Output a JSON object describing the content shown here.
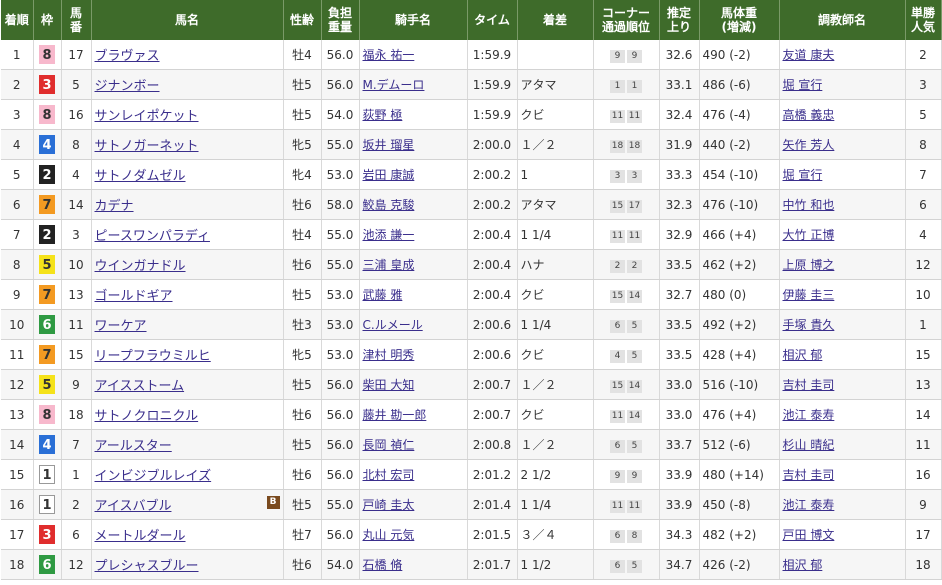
{
  "headers": [
    "着順",
    "枠",
    "馬\n番",
    "馬名",
    "性齢",
    "負担\n重量",
    "騎手名",
    "タイム",
    "着差",
    "コーナー\n通過順位",
    "推定\n上り",
    "馬体重\n(増減)",
    "調教師名",
    "単勝\n人気"
  ],
  "waku_colors": {
    "1": {
      "bg": "#ffffff",
      "fg": "#333333",
      "border": "#999999"
    },
    "2": {
      "bg": "#222222",
      "fg": "#ffffff",
      "border": "#222222"
    },
    "3": {
      "bg": "#e02d2d",
      "fg": "#ffffff",
      "border": "#e02d2d"
    },
    "4": {
      "bg": "#2a6fd6",
      "fg": "#ffffff",
      "border": "#2a6fd6"
    },
    "5": {
      "bg": "#f5e21a",
      "fg": "#333333",
      "border": "#f5e21a"
    },
    "6": {
      "bg": "#2f9a43",
      "fg": "#ffffff",
      "border": "#2f9a43"
    },
    "7": {
      "bg": "#f39a22",
      "fg": "#333333",
      "border": "#f39a22"
    },
    "8": {
      "bg": "#f7b8cc",
      "fg": "#333333",
      "border": "#f7b8cc"
    }
  },
  "rows": [
    {
      "rank": "1",
      "waku": "8",
      "umaban": "17",
      "horse": "ブラヴァス",
      "sex_age": "牡4",
      "weight": "56.0",
      "jockey": "福永 祐一",
      "time": "1:59.9",
      "margin": "",
      "corner": [
        "9",
        "9"
      ],
      "last3f": "32.6",
      "body_weight": "490 (-2)",
      "trainer": "友道 康夫",
      "popularity": "2"
    },
    {
      "rank": "2",
      "waku": "3",
      "umaban": "5",
      "horse": "ジナンボー",
      "sex_age": "牡5",
      "weight": "56.0",
      "jockey": "M.デムーロ",
      "time": "1:59.9",
      "margin": "アタマ",
      "corner": [
        "1",
        "1"
      ],
      "last3f": "33.1",
      "body_weight": "486 (-6)",
      "trainer": "堀 宣行",
      "popularity": "3"
    },
    {
      "rank": "3",
      "waku": "8",
      "umaban": "16",
      "horse": "サンレイポケット",
      "sex_age": "牡5",
      "weight": "54.0",
      "jockey": "荻野 極",
      "time": "1:59.9",
      "margin": "クビ",
      "corner": [
        "11",
        "11"
      ],
      "last3f": "32.4",
      "body_weight": "476 (-4)",
      "trainer": "高橋 義忠",
      "popularity": "5"
    },
    {
      "rank": "4",
      "waku": "4",
      "umaban": "8",
      "horse": "サトノガーネット",
      "sex_age": "牝5",
      "weight": "55.0",
      "jockey": "坂井 瑠星",
      "time": "2:00.0",
      "margin": "１／２",
      "corner": [
        "18",
        "18"
      ],
      "last3f": "31.9",
      "body_weight": "440 (-2)",
      "trainer": "矢作 芳人",
      "popularity": "8"
    },
    {
      "rank": "5",
      "waku": "2",
      "umaban": "4",
      "horse": "サトノダムゼル",
      "sex_age": "牝4",
      "weight": "53.0",
      "jockey": "岩田 康誠",
      "time": "2:00.2",
      "margin": "1",
      "corner": [
        "3",
        "3"
      ],
      "last3f": "33.3",
      "body_weight": "454 (-10)",
      "trainer": "堀 宣行",
      "popularity": "7"
    },
    {
      "rank": "6",
      "waku": "7",
      "umaban": "14",
      "horse": "カデナ",
      "sex_age": "牡6",
      "weight": "58.0",
      "jockey": "鮫島 克駿",
      "time": "2:00.2",
      "margin": "アタマ",
      "corner": [
        "15",
        "17"
      ],
      "last3f": "32.3",
      "body_weight": "476 (-10)",
      "trainer": "中竹 和也",
      "popularity": "6"
    },
    {
      "rank": "7",
      "waku": "2",
      "umaban": "3",
      "horse": "ピースワンパラディ",
      "sex_age": "牡4",
      "weight": "55.0",
      "jockey": "池添 謙一",
      "time": "2:00.4",
      "margin": "1 1/4",
      "corner": [
        "11",
        "11"
      ],
      "last3f": "32.9",
      "body_weight": "466 (+4)",
      "trainer": "大竹 正博",
      "popularity": "4"
    },
    {
      "rank": "8",
      "waku": "5",
      "umaban": "10",
      "horse": "ウインガナドル",
      "sex_age": "牡6",
      "weight": "55.0",
      "jockey": "三浦 皇成",
      "time": "2:00.4",
      "margin": "ハナ",
      "corner": [
        "2",
        "2"
      ],
      "last3f": "33.5",
      "body_weight": "462 (+2)",
      "trainer": "上原 博之",
      "popularity": "12"
    },
    {
      "rank": "9",
      "waku": "7",
      "umaban": "13",
      "horse": "ゴールドギア",
      "sex_age": "牡5",
      "weight": "53.0",
      "jockey": "武藤 雅",
      "time": "2:00.4",
      "margin": "クビ",
      "corner": [
        "15",
        "14"
      ],
      "last3f": "32.7",
      "body_weight": "480 (0)",
      "trainer": "伊藤 圭三",
      "popularity": "10"
    },
    {
      "rank": "10",
      "waku": "6",
      "umaban": "11",
      "horse": "ワーケア",
      "sex_age": "牡3",
      "weight": "53.0",
      "jockey": "C.ルメール",
      "time": "2:00.6",
      "margin": "1 1/4",
      "corner": [
        "6",
        "5"
      ],
      "last3f": "33.5",
      "body_weight": "492 (+2)",
      "trainer": "手塚 貴久",
      "popularity": "1"
    },
    {
      "rank": "11",
      "waku": "7",
      "umaban": "15",
      "horse": "リープフラウミルヒ",
      "sex_age": "牝5",
      "weight": "53.0",
      "jockey": "津村 明秀",
      "time": "2:00.6",
      "margin": "クビ",
      "corner": [
        "4",
        "5"
      ],
      "last3f": "33.5",
      "body_weight": "428 (+4)",
      "trainer": "相沢 郁",
      "popularity": "15"
    },
    {
      "rank": "12",
      "waku": "5",
      "umaban": "9",
      "horse": "アイスストーム",
      "sex_age": "牡5",
      "weight": "56.0",
      "jockey": "柴田 大知",
      "time": "2:00.7",
      "margin": "１／２",
      "corner": [
        "15",
        "14"
      ],
      "last3f": "33.0",
      "body_weight": "516 (-10)",
      "trainer": "吉村 圭司",
      "popularity": "13"
    },
    {
      "rank": "13",
      "waku": "8",
      "umaban": "18",
      "horse": "サトノクロニクル",
      "sex_age": "牡6",
      "weight": "56.0",
      "jockey": "藤井 勘一郎",
      "time": "2:00.7",
      "margin": "クビ",
      "corner": [
        "11",
        "14"
      ],
      "last3f": "33.0",
      "body_weight": "476 (+4)",
      "trainer": "池江 泰寿",
      "popularity": "14"
    },
    {
      "rank": "14",
      "waku": "4",
      "umaban": "7",
      "horse": "アールスター",
      "sex_age": "牡5",
      "weight": "56.0",
      "jockey": "長岡 禎仁",
      "time": "2:00.8",
      "margin": "１／２",
      "corner": [
        "6",
        "5"
      ],
      "last3f": "33.7",
      "body_weight": "512 (-6)",
      "trainer": "杉山 晴紀",
      "popularity": "11"
    },
    {
      "rank": "15",
      "waku": "1",
      "umaban": "1",
      "horse": "インビジブルレイズ",
      "sex_age": "牡6",
      "weight": "56.0",
      "jockey": "北村 宏司",
      "time": "2:01.2",
      "margin": "2 1/2",
      "corner": [
        "9",
        "9"
      ],
      "last3f": "33.9",
      "body_weight": "480 (+14)",
      "trainer": "吉村 圭司",
      "popularity": "16"
    },
    {
      "rank": "16",
      "waku": "1",
      "umaban": "2",
      "horse": "アイスバブル",
      "blinker": "B",
      "sex_age": "牡5",
      "weight": "55.0",
      "jockey": "戸崎 圭太",
      "time": "2:01.4",
      "margin": "1 1/4",
      "corner": [
        "11",
        "11"
      ],
      "last3f": "33.9",
      "body_weight": "450 (-8)",
      "trainer": "池江 泰寿",
      "popularity": "9"
    },
    {
      "rank": "17",
      "waku": "3",
      "umaban": "6",
      "horse": "メートルダール",
      "sex_age": "牡7",
      "weight": "56.0",
      "jockey": "丸山 元気",
      "time": "2:01.5",
      "margin": "３／４",
      "corner": [
        "6",
        "8"
      ],
      "last3f": "34.3",
      "body_weight": "482 (+2)",
      "trainer": "戸田 博文",
      "popularity": "17"
    },
    {
      "rank": "18",
      "waku": "6",
      "umaban": "12",
      "horse": "プレシャスブルー",
      "sex_age": "牡6",
      "weight": "54.0",
      "jockey": "石橋 脩",
      "time": "2:01.7",
      "margin": "1 1/2",
      "corner": [
        "6",
        "5"
      ],
      "last3f": "34.7",
      "body_weight": "426 (-2)",
      "trainer": "相沢 郁",
      "popularity": "18"
    }
  ]
}
